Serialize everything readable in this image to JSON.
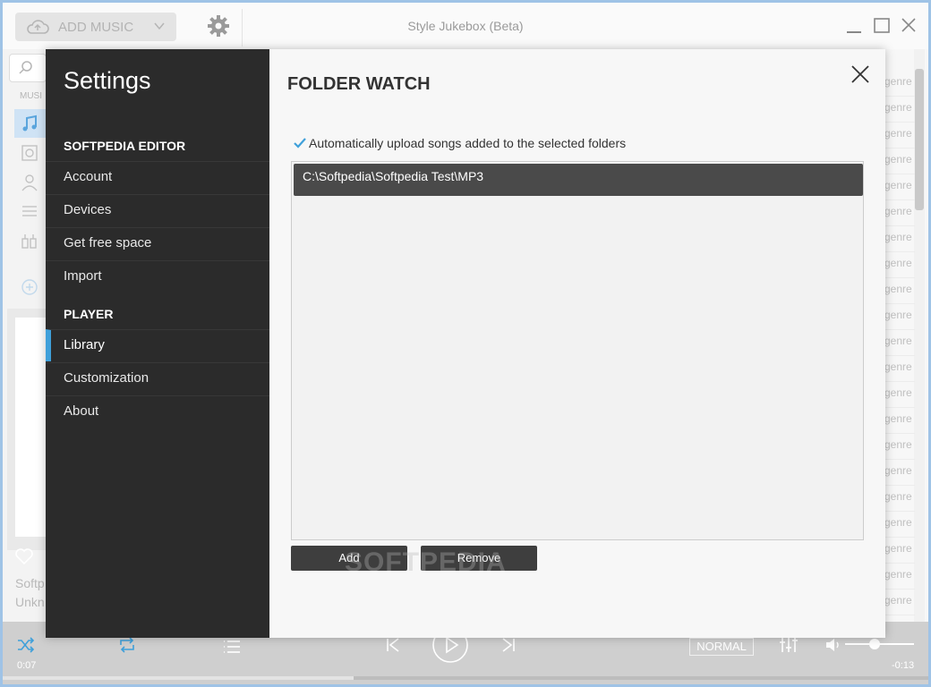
{
  "app": {
    "title": "Style Jukebox (Beta)",
    "add_music_label": "ADD MUSIC"
  },
  "background": {
    "nav_section_label": "MUSI",
    "genre_label": "genre",
    "now_playing_title": "Softp",
    "now_playing_artist": "Unkn"
  },
  "player": {
    "time_elapsed": "0:07",
    "time_remaining": "-0:13",
    "mode_label": "NORMAL",
    "progress_fraction": 0.38,
    "volume_fraction": 0.43
  },
  "settings": {
    "title": "Settings",
    "sections": [
      {
        "label": "SOFTPEDIA EDITOR",
        "items": [
          "Account",
          "Devices",
          "Get free space",
          "Import"
        ]
      },
      {
        "label": "PLAYER",
        "items": [
          "Library",
          "Customization",
          "About"
        ]
      }
    ],
    "active_item": "Library",
    "accent_color": "#3fa0da"
  },
  "folder_watch": {
    "heading": "FOLDER WATCH",
    "auto_upload_label": "Automatically upload songs added to the selected folders",
    "auto_upload_checked": true,
    "folders": [
      "C:\\Softpedia\\Softpedia Test\\MP3"
    ],
    "add_button": "Add",
    "remove_button": "Remove"
  },
  "watermark": "SOFTPEDIA"
}
